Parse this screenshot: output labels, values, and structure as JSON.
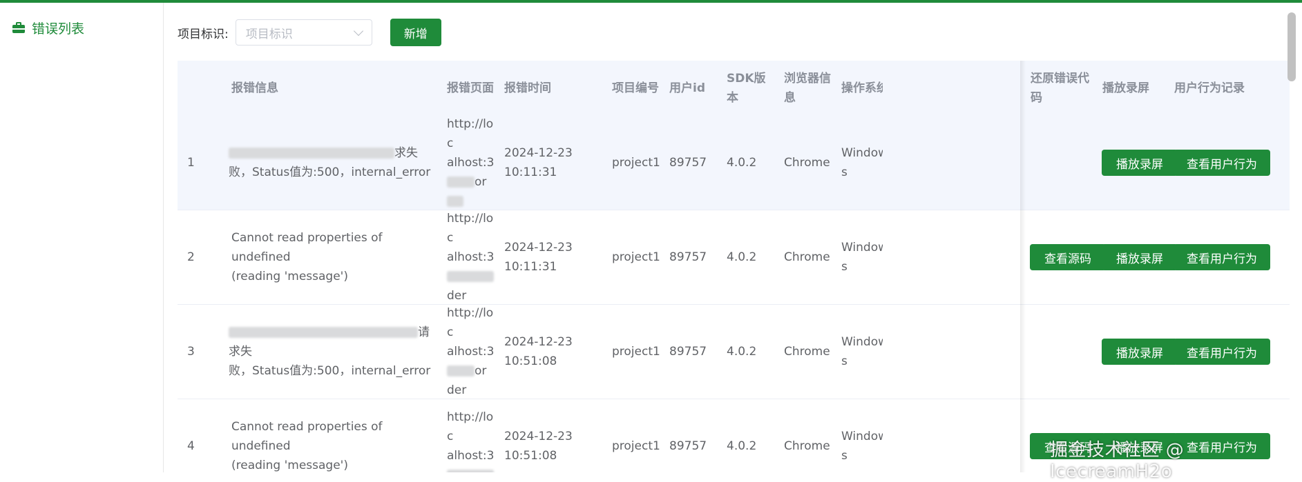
{
  "sidebar": {
    "menu_label": "错误列表",
    "menu_icon": "briefcase-icon"
  },
  "filter": {
    "label": "项目标识:",
    "placeholder": "项目标识",
    "add_button": "新增"
  },
  "table": {
    "headers": {
      "message": "报错信息",
      "page": "报错页面",
      "time": "报错时间",
      "project": "项目编号",
      "user": "用户id",
      "sdk": "SDK版本",
      "browser": "浏览器信息",
      "os": "操作系统",
      "restore": "还原错误代码",
      "replay": "播放录屏",
      "behavior": "用户行为记录"
    },
    "rows": [
      {
        "index": "1",
        "msg_line1_visible": "求失",
        "msg_line2": "败，Status值为:500，internal_error",
        "page_lines": [
          "http://loc",
          "alhost:3",
          "or"
        ],
        "time_line1": "2024-12-23",
        "time_line2": "10:11:31",
        "project": "project1",
        "user": "89757",
        "sdk": "4.0.2",
        "browser": "Chrome",
        "os_line1": "Window",
        "os_line2": "s",
        "restore_button": "",
        "replay_button": "播放录屏",
        "behavior_button": "查看用户行为"
      },
      {
        "index": "2",
        "msg_line1": "Cannot read properties of undefined",
        "msg_line2": "(reading 'message')",
        "page_lines": [
          "http://loc",
          "alhost:3",
          "der"
        ],
        "time_line1": "2024-12-23",
        "time_line2": "10:11:31",
        "project": "project1",
        "user": "89757",
        "sdk": "4.0.2",
        "browser": "Chrome",
        "os_line1": "Window",
        "os_line2": "s",
        "restore_button": "查看源码",
        "replay_button": "播放录屏",
        "behavior_button": "查看用户行为"
      },
      {
        "index": "3",
        "msg_line1_visible": "请求失",
        "msg_line2": "败，Status值为:500，internal_error",
        "page_lines": [
          "http://loc",
          "alhost:3",
          "or",
          "der"
        ],
        "time_line1": "2024-12-23",
        "time_line2": "10:51:08",
        "project": "project1",
        "user": "89757",
        "sdk": "4.0.2",
        "browser": "Chrome",
        "os_line1": "Window",
        "os_line2": "s",
        "restore_button": "",
        "replay_button": "播放录屏",
        "behavior_button": "查看用户行为"
      },
      {
        "index": "4",
        "msg_line1": "Cannot read properties of undefined",
        "msg_line2": "(reading 'message')",
        "page_lines": [
          "http://loc",
          "alhost:3"
        ],
        "time_line1": "2024-12-23",
        "time_line2": "10:51:08",
        "project": "project1",
        "user": "89757",
        "sdk": "4.0.2",
        "browser": "Chrome",
        "os_line1": "Window",
        "os_line2": "s",
        "restore_button": "查看源码",
        "replay_button": "播放录屏",
        "behavior_button": "查看用户行为"
      }
    ]
  },
  "watermark": "掘金技术社区 @ IcecreamH2o",
  "colors": {
    "primary": "#1f8b3a",
    "header_bg": "#f3f6fd"
  }
}
